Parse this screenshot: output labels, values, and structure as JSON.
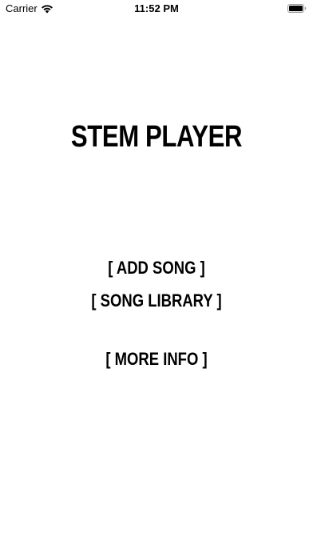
{
  "status_bar": {
    "carrier": "Carrier",
    "time": "11:52 PM",
    "icons": [
      "wifi-icon",
      "battery-icon"
    ]
  },
  "app": {
    "title": "STEM PLAYER"
  },
  "menu": {
    "add_song": "[ ADD SONG ]",
    "song_library": "[ SONG LIBRARY ]",
    "more_info": "[ MORE INFO ]"
  },
  "colors": {
    "background": "#ffffff",
    "text": "#000000"
  }
}
